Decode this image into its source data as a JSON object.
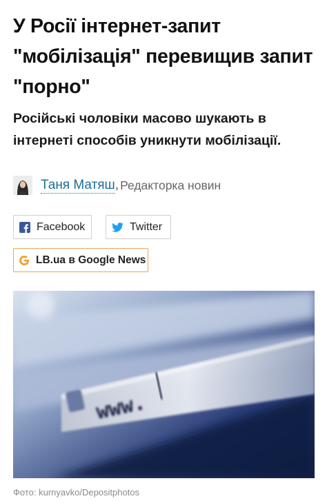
{
  "article": {
    "headline": "У Росії інтернет-запит \"мобілізація\" перевищив запит \"порно\"",
    "lead": "Російські чоловіки масово шукають в інтернеті способів уникнути мобілізації."
  },
  "author": {
    "name": "Таня Матяш",
    "separator": ",",
    "role": "Редакторка новин"
  },
  "share": {
    "facebook_label": "Facebook",
    "twitter_label": "Twitter",
    "google_news_label": "LB.ua в Google News"
  },
  "image": {
    "caption": "Фото: kurnyavko/Depositphotos",
    "address_bar_text": "www."
  },
  "colors": {
    "link": "#1b6e9a",
    "facebook": "#3b5998",
    "twitter": "#1da1f2",
    "google_news_border": "#e6a74f",
    "google_g": "#f0a030"
  }
}
